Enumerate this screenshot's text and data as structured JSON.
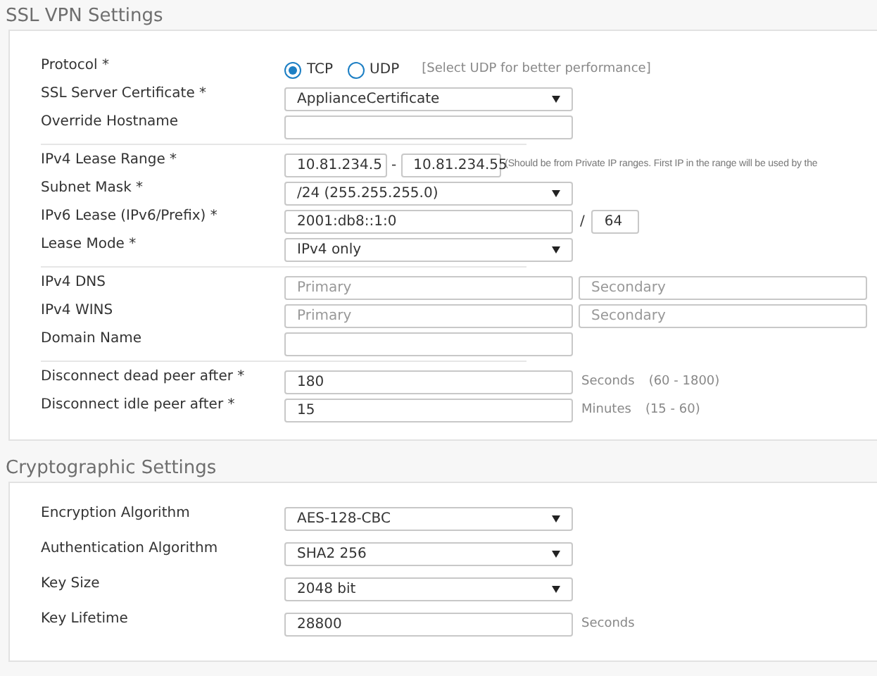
{
  "sections": [
    {
      "title": "SSL VPN Settings",
      "groups": [
        [
          {
            "kind": "radio",
            "label": "Protocol *",
            "options": [
              {
                "label": "TCP",
                "selected": true
              },
              {
                "label": "UDP",
                "selected": false
              }
            ],
            "hint": "[Select UDP for better performance]"
          },
          {
            "kind": "select",
            "label": "SSL Server Certificate *",
            "value": "ApplianceCertificate"
          },
          {
            "kind": "text",
            "label": "Override Hostname"
          }
        ],
        [
          {
            "kind": "range",
            "label": "IPv4 Lease Range *",
            "from": "10.81.234.5",
            "separator": "-",
            "to": "10.81.234.55",
            "hint": "(Should be from Private IP ranges. First IP in the range will be used by the"
          },
          {
            "kind": "select",
            "label": "Subnet Mask *",
            "value": "/24 (255.255.255.0)"
          },
          {
            "kind": "prefix",
            "label": "IPv6 Lease (IPv6/Prefix) *",
            "value": "2001:db8::1:0",
            "separator": "/",
            "prefix": "64"
          },
          {
            "kind": "select",
            "label": "Lease Mode *",
            "value": "IPv4 only"
          }
        ],
        [
          {
            "kind": "pair",
            "label": "IPv4 DNS",
            "placeholders": [
              "Primary",
              "Secondary"
            ]
          },
          {
            "kind": "pair",
            "label": "IPv4 WINS",
            "placeholders": [
              "Primary",
              "Secondary"
            ]
          },
          {
            "kind": "text",
            "label": "Domain Name"
          }
        ],
        [
          {
            "kind": "text",
            "label": "Disconnect dead peer after *",
            "value": "180",
            "unit": "Seconds",
            "hint": "(60 - 1800)"
          },
          {
            "kind": "text",
            "label": "Disconnect idle peer after *",
            "value": "15",
            "unit": "Minutes",
            "hint": "(15 - 60)"
          }
        ]
      ]
    },
    {
      "title": "Cryptographic Settings",
      "groups": [
        [
          {
            "kind": "select",
            "label": "Encryption Algorithm",
            "value": "AES-128-CBC"
          },
          {
            "kind": "select",
            "label": "Authentication Algorithm",
            "value": "SHA2 256"
          },
          {
            "kind": "select",
            "label": "Key Size",
            "value": "2048 bit"
          },
          {
            "kind": "text",
            "label": "Key Lifetime",
            "value": "28800",
            "unit": "Seconds"
          }
        ]
      ]
    }
  ]
}
